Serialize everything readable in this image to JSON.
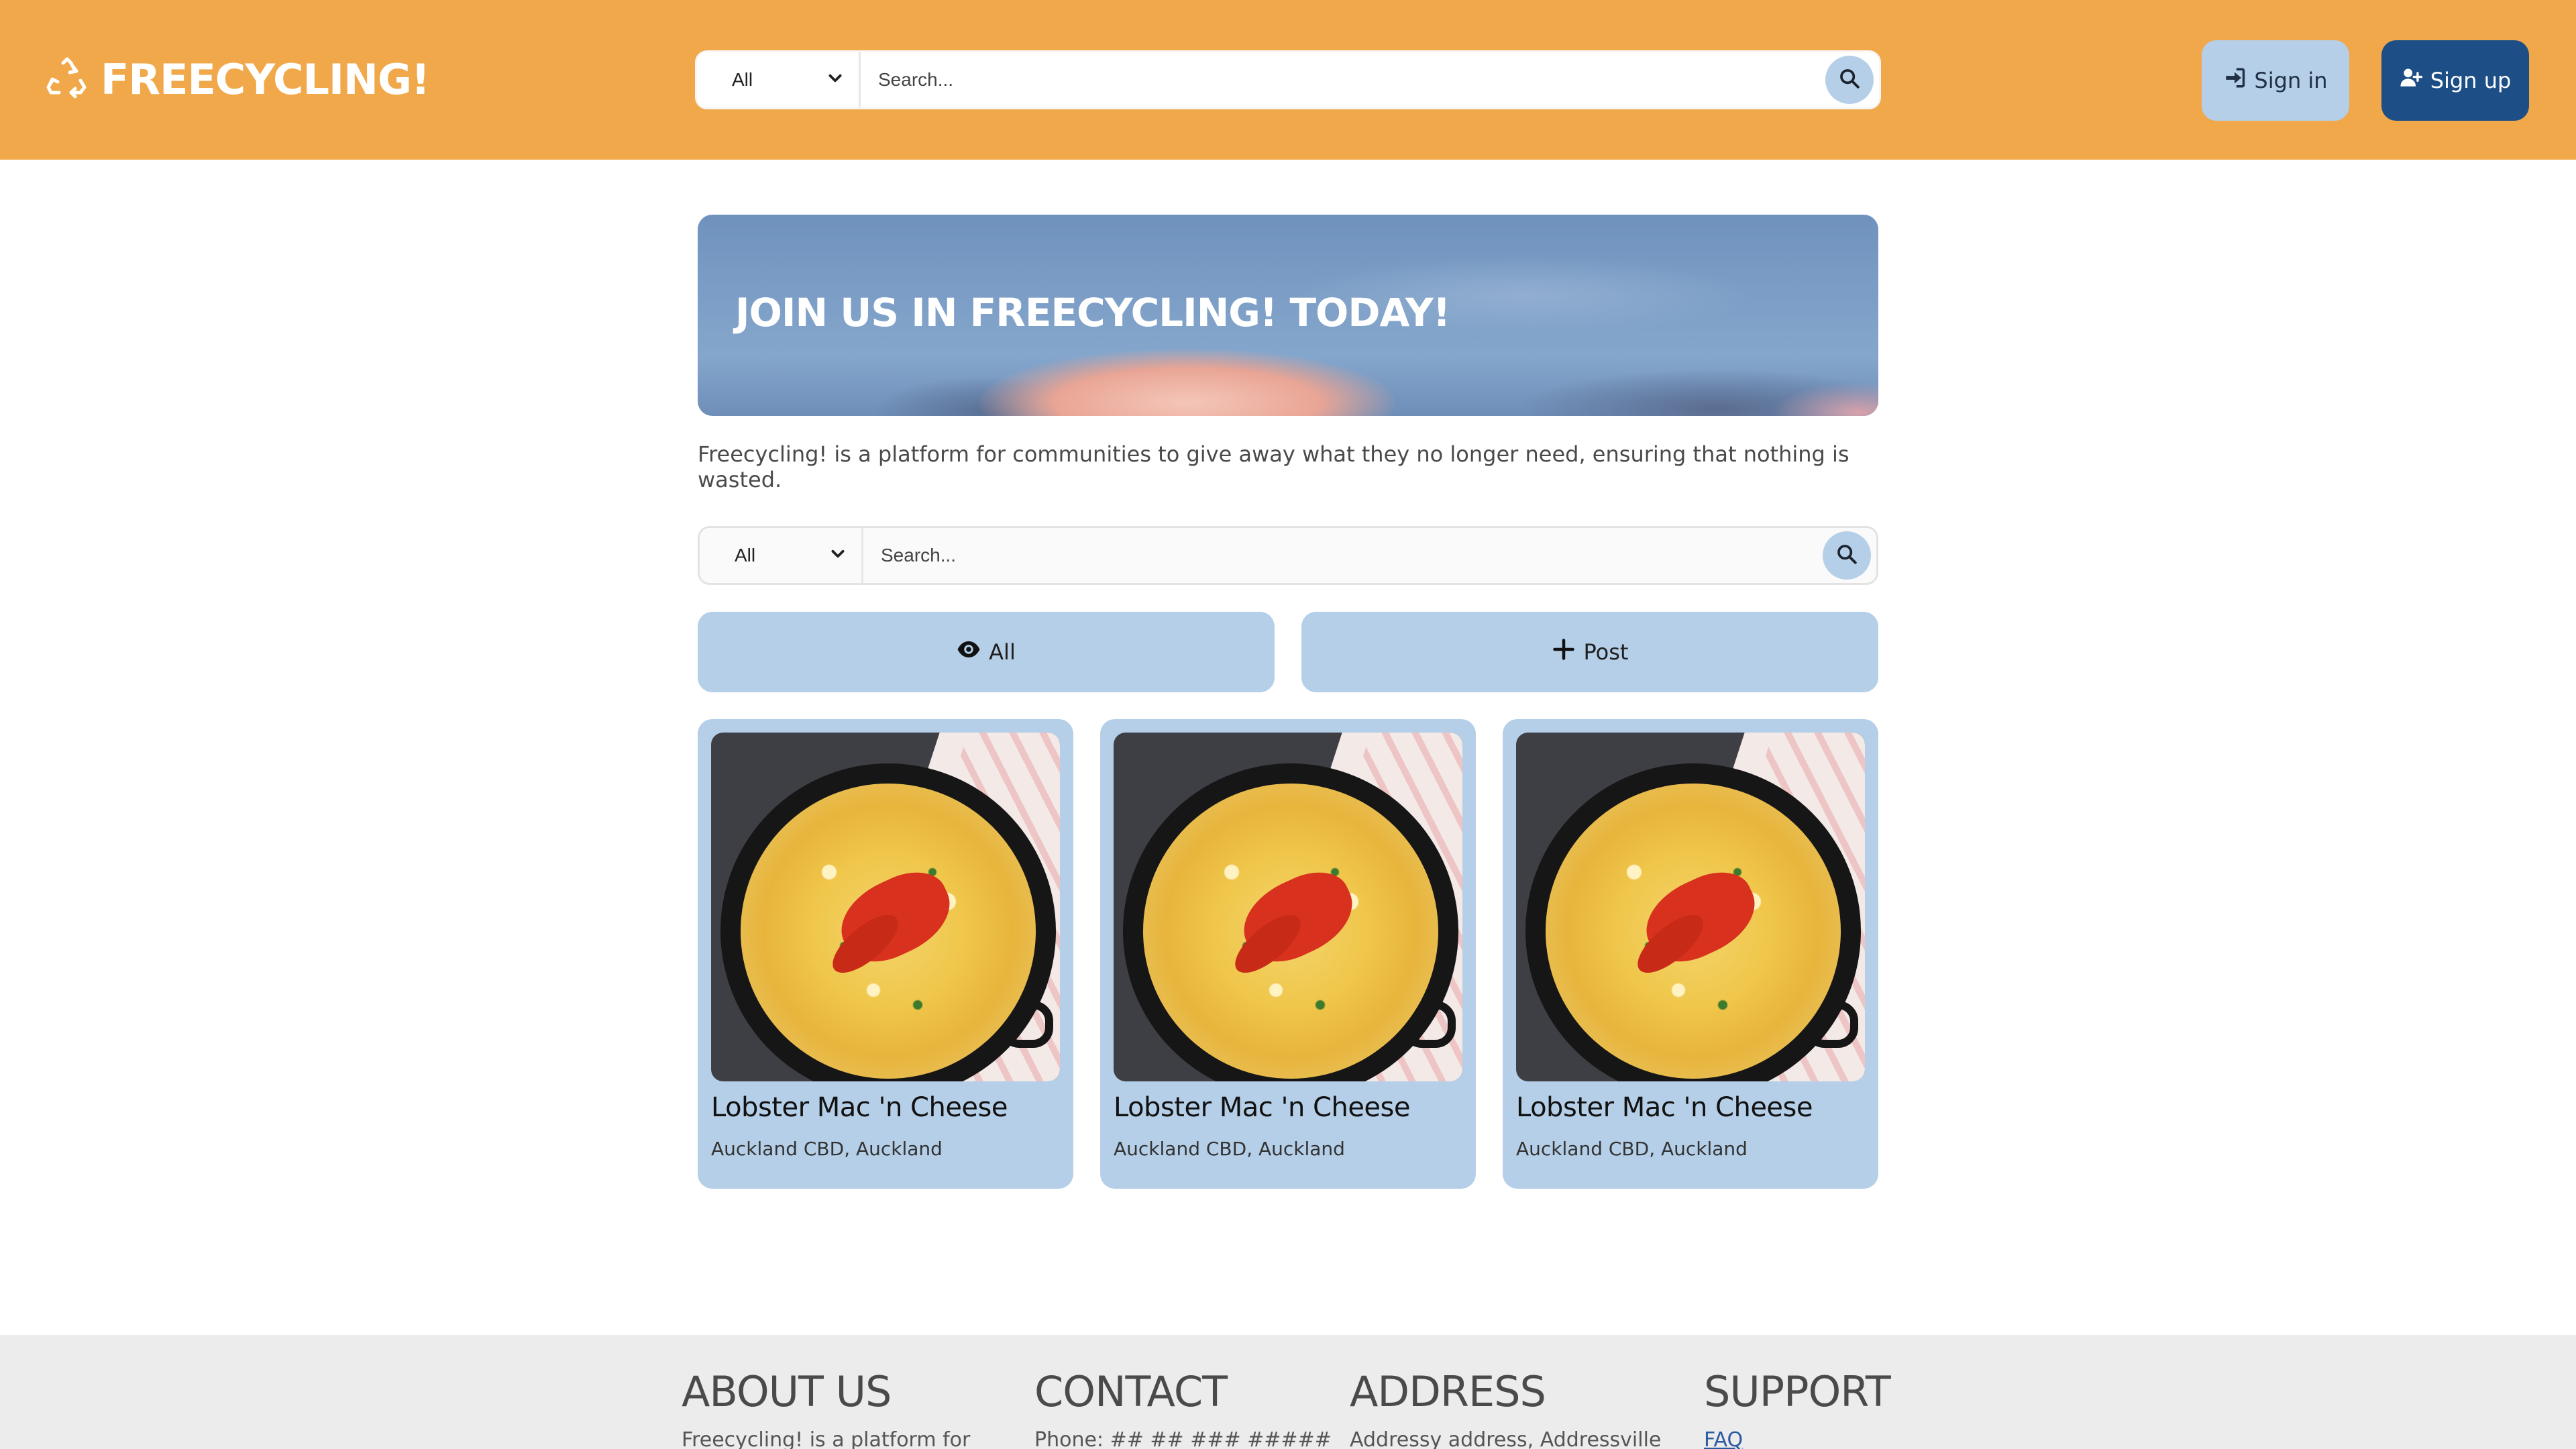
{
  "header": {
    "brand": "FREECYCLING!",
    "search": {
      "category": "All",
      "placeholder": "Search..."
    },
    "sign_in": "Sign in",
    "sign_up": "Sign up"
  },
  "hero": {
    "title": "JOIN US IN FREECYCLING! TODAY!"
  },
  "intro": "Freecycling! is a platform for communities to give away what they no longer need, ensuring that nothing is wasted.",
  "main_search": {
    "category": "All",
    "placeholder": "Search..."
  },
  "actions": {
    "all": "All",
    "post": "Post"
  },
  "listings": [
    {
      "title": "Lobster Mac 'n Cheese",
      "location": "Auckland CBD, Auckland"
    },
    {
      "title": "Lobster Mac 'n Cheese",
      "location": "Auckland CBD, Auckland"
    },
    {
      "title": "Lobster Mac 'n Cheese",
      "location": "Auckland CBD, Auckland"
    }
  ],
  "footer": {
    "about": {
      "heading": "ABOUT US",
      "text": "Freecycling! is a platform for"
    },
    "contact": {
      "heading": "CONTACT",
      "text": "Phone: ## ## ### #####"
    },
    "address": {
      "heading": "ADDRESS",
      "text": "Addressy address, Addressville"
    },
    "support": {
      "heading": "SUPPORT",
      "link": "FAQ"
    }
  },
  "icons": {
    "brand": "recycle-icon",
    "search": "search-icon",
    "dropdown": "chevron-down-icon",
    "sign_in": "sign-in-icon",
    "sign_up": "user-plus-icon",
    "all": "eye-icon",
    "post": "plus-icon"
  },
  "colors": {
    "header_bg": "#f0a84a",
    "accent_light": "#b5cfe8",
    "accent_dark": "#1d4f86",
    "footer_bg": "#ececec"
  }
}
